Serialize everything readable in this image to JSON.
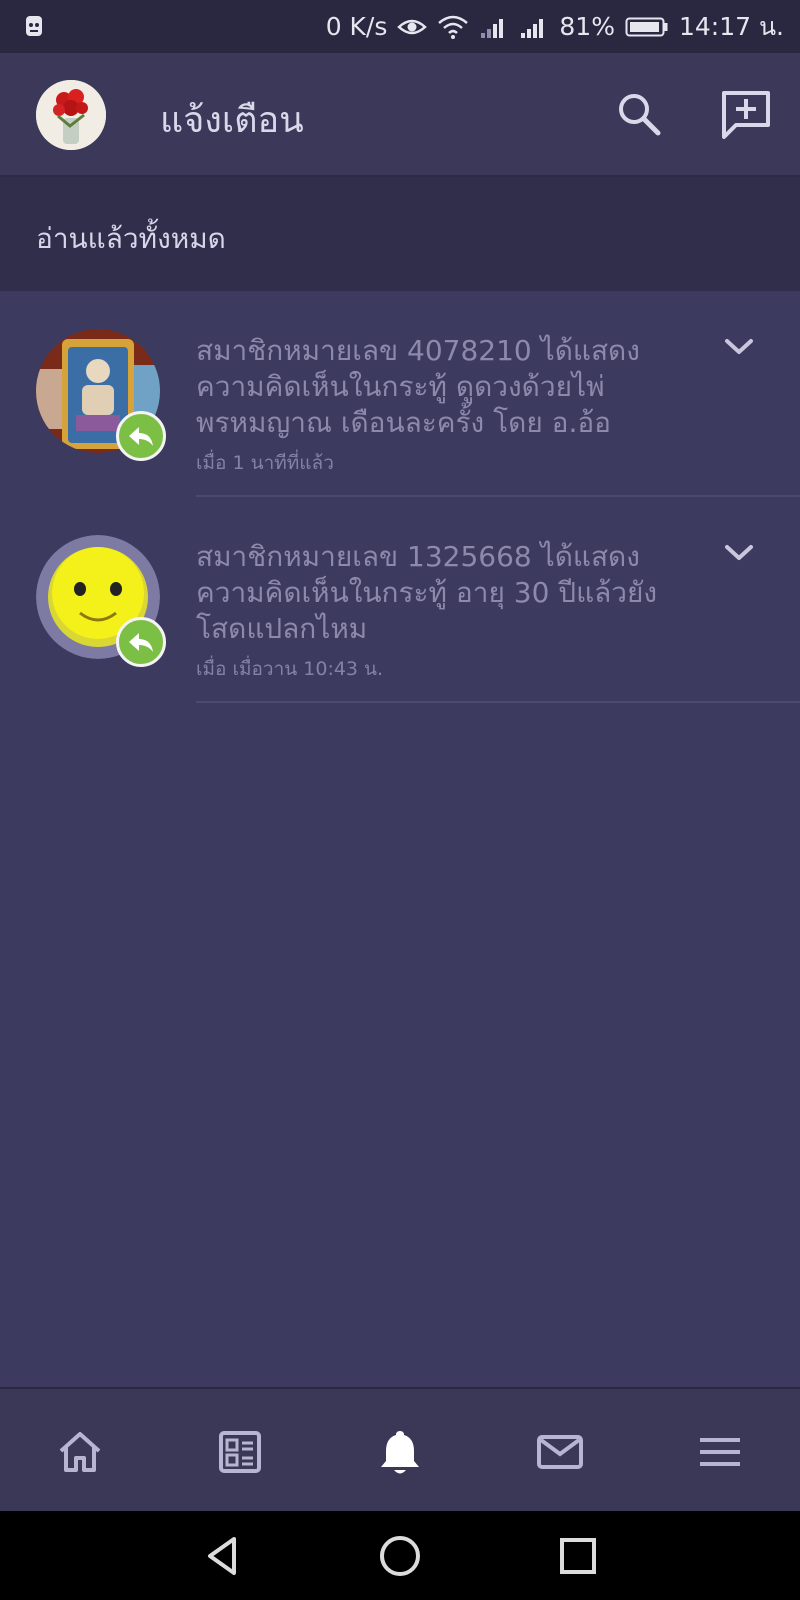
{
  "status": {
    "speed": "0 K/s",
    "battery": "81%",
    "time": "14:17 น."
  },
  "appbar": {
    "title": "แจ้งเตือน"
  },
  "mark_all_label": "อ่านแล้วทั้งหมด",
  "notifications": [
    {
      "line1": "สมาชิกหมายเลข 4078210 ได้แสดง",
      "line2": "ความคิดเห็นในกระทู้ ดูดวงด้วยไพ่",
      "line3": "พรหมญาณ เดือนละครั้ง โดย อ.อ้อ",
      "time": "เมื่อ 1 นาทีที่แล้ว"
    },
    {
      "line1": "สมาชิกหมายเลข 1325668 ได้แสดง",
      "line2": "ความคิดเห็นในกระทู้ อายุ 30 ปีแล้วยัง",
      "line3": "โสดแปลกไหม",
      "time": "เมื่อ เมื่อวาน  10:43 น."
    }
  ],
  "icons": {
    "top": [
      "search-icon",
      "compose-icon"
    ],
    "bottom_nav": [
      "home-icon",
      "feed-icon",
      "bell-icon",
      "mail-icon",
      "menu-icon"
    ],
    "system_nav": [
      "back-icon",
      "home-circle-icon",
      "recents-icon"
    ]
  },
  "colors": {
    "background": "#3d3a60",
    "appbar": "#3b3859",
    "reply_badge": "#7cbf45",
    "active_nav": "#ffffff"
  }
}
